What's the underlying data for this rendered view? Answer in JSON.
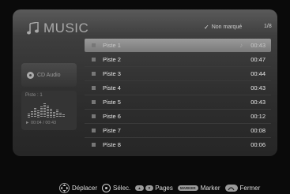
{
  "app": {
    "title": "MUSIC"
  },
  "header": {
    "filter_label": "Non marqué",
    "page": "1/8"
  },
  "side": {
    "source_label": "CD Audio",
    "playing_label": "Piste : 1",
    "time": "► 00:04 / 00:43"
  },
  "tracks": [
    {
      "name": "Piste 1",
      "duration": "00:43",
      "selected": true,
      "playing": true
    },
    {
      "name": "Piste 2",
      "duration": "00:47"
    },
    {
      "name": "Piste 3",
      "duration": "00:44"
    },
    {
      "name": "Piste 4",
      "duration": "00:43"
    },
    {
      "name": "Piste 5",
      "duration": "00:43"
    },
    {
      "name": "Piste 6",
      "duration": "00:12"
    },
    {
      "name": "Piste 7",
      "duration": "00:08"
    },
    {
      "name": "Piste 8",
      "duration": "00:06"
    }
  ],
  "footer": {
    "move": "Déplacer",
    "select": "Sélec.",
    "pages": "Pages",
    "marker_key": "MARKER",
    "marker": "Marker",
    "close": "Fermer"
  },
  "icons": {
    "title": "music-note-icon",
    "source": "disc-icon",
    "playing_note": "music-note-icon",
    "nav": "dpad-icon",
    "ok": "ok-button-icon",
    "return": "return-icon"
  },
  "colors": {
    "panel": "#3e3e3e",
    "selection": "#8a8a8a",
    "text": "#e8e8e8"
  }
}
